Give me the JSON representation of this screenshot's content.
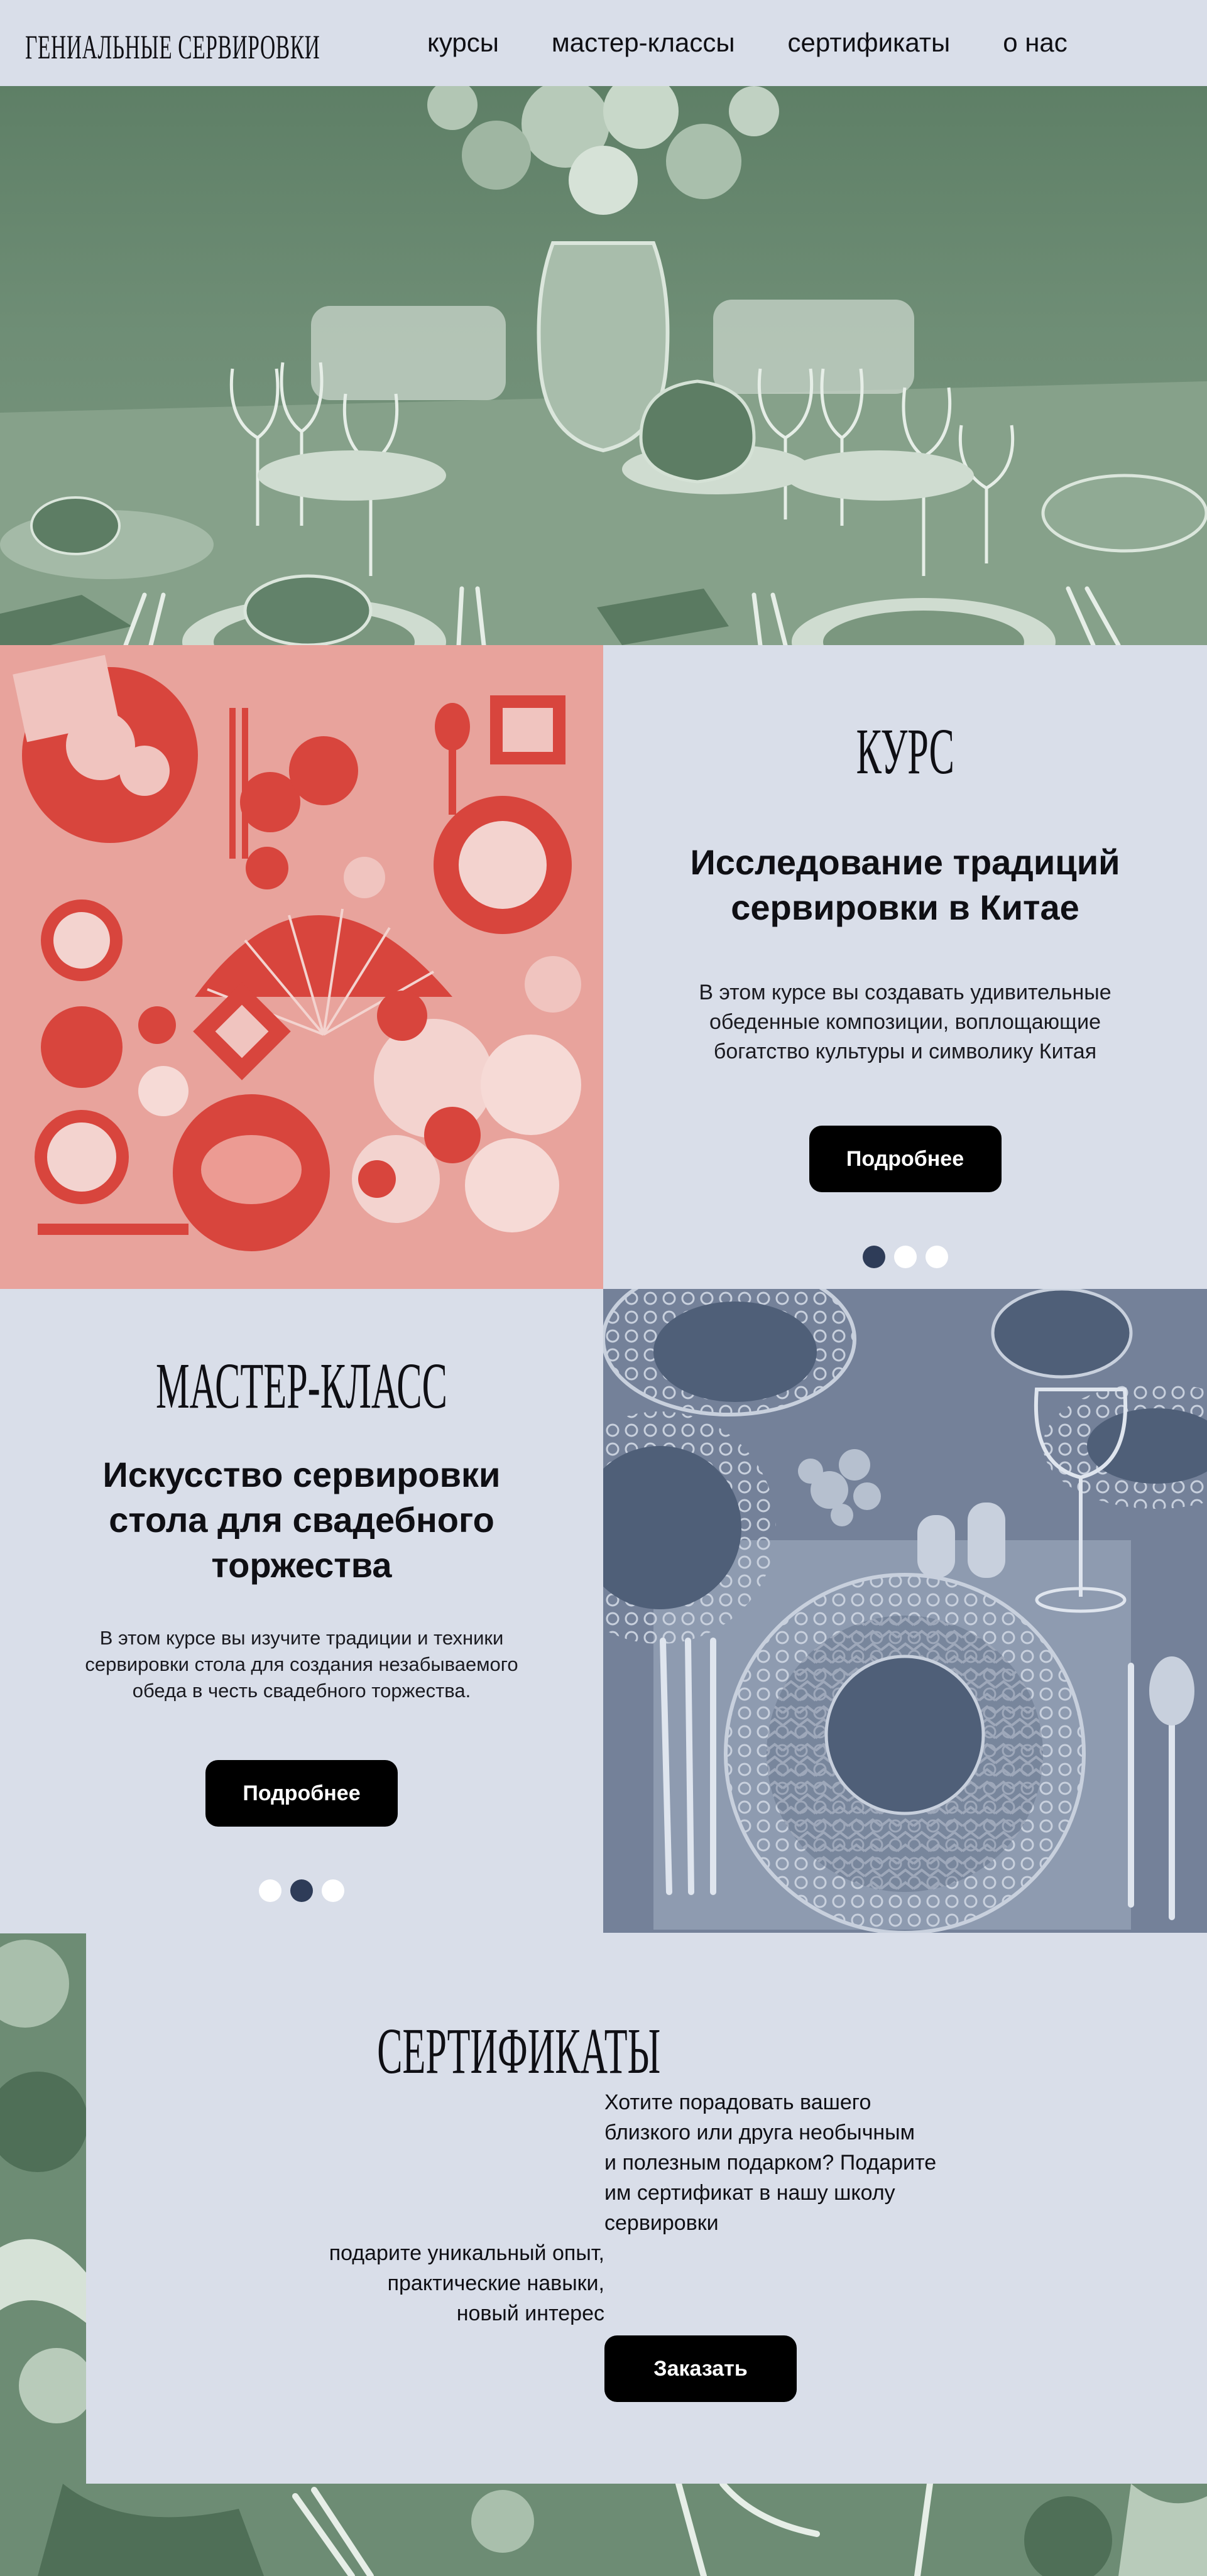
{
  "nav": {
    "logo": "ГЕНИАЛЬНЫЕ СЕРВИРОВКИ",
    "items": [
      "курсы",
      "мастер-классы",
      "сертификаты",
      "о нас"
    ]
  },
  "course": {
    "tag": "КУРС",
    "title_line1": "Исследование традиций",
    "title_line2": "сервировки в Китае",
    "desc_line1": "В этом курсе вы  создавать удивительные",
    "desc_line2": "обеденные композиции, воплощающие",
    "desc_line3": "богатство культуры и символику Китая",
    "button": "Подробнее",
    "active_dot": 0
  },
  "masterclass": {
    "tag": "МАСТЕР-КЛАСС",
    "title_line1": "Искусство сервировки",
    "title_line2": "стола для свадебного",
    "title_line3": "торжества",
    "desc_line1": "В этом курсе вы изучите традиции и техники",
    "desc_line2": "сервировки стола для создания незабываемого",
    "desc_line3": "обеда в честь свадебного торжества.",
    "button": "Подробнее",
    "active_dot": 1
  },
  "certificates": {
    "tag": "СЕРТИФИКАТЫ",
    "right_line1": "Хотите порадовать вашего",
    "right_line2": "близкого или друга необычным",
    "right_line3": "и полезным подарком? Подарите",
    "right_line4": "им сертификат в нашу  школу",
    "right_line5": "сервировки",
    "left_line1": "подарите уникальный опыт,",
    "left_line2": "практические навыки,",
    "left_line3": "новый интерес",
    "button": "Заказать"
  },
  "colors": {
    "background": "#d9dee9",
    "green_tint": "#6d8c74",
    "red_tint": "#d8453d",
    "blue_tint": "#4f5f78",
    "button": "#000000",
    "dot_active": "#2e3c58"
  }
}
